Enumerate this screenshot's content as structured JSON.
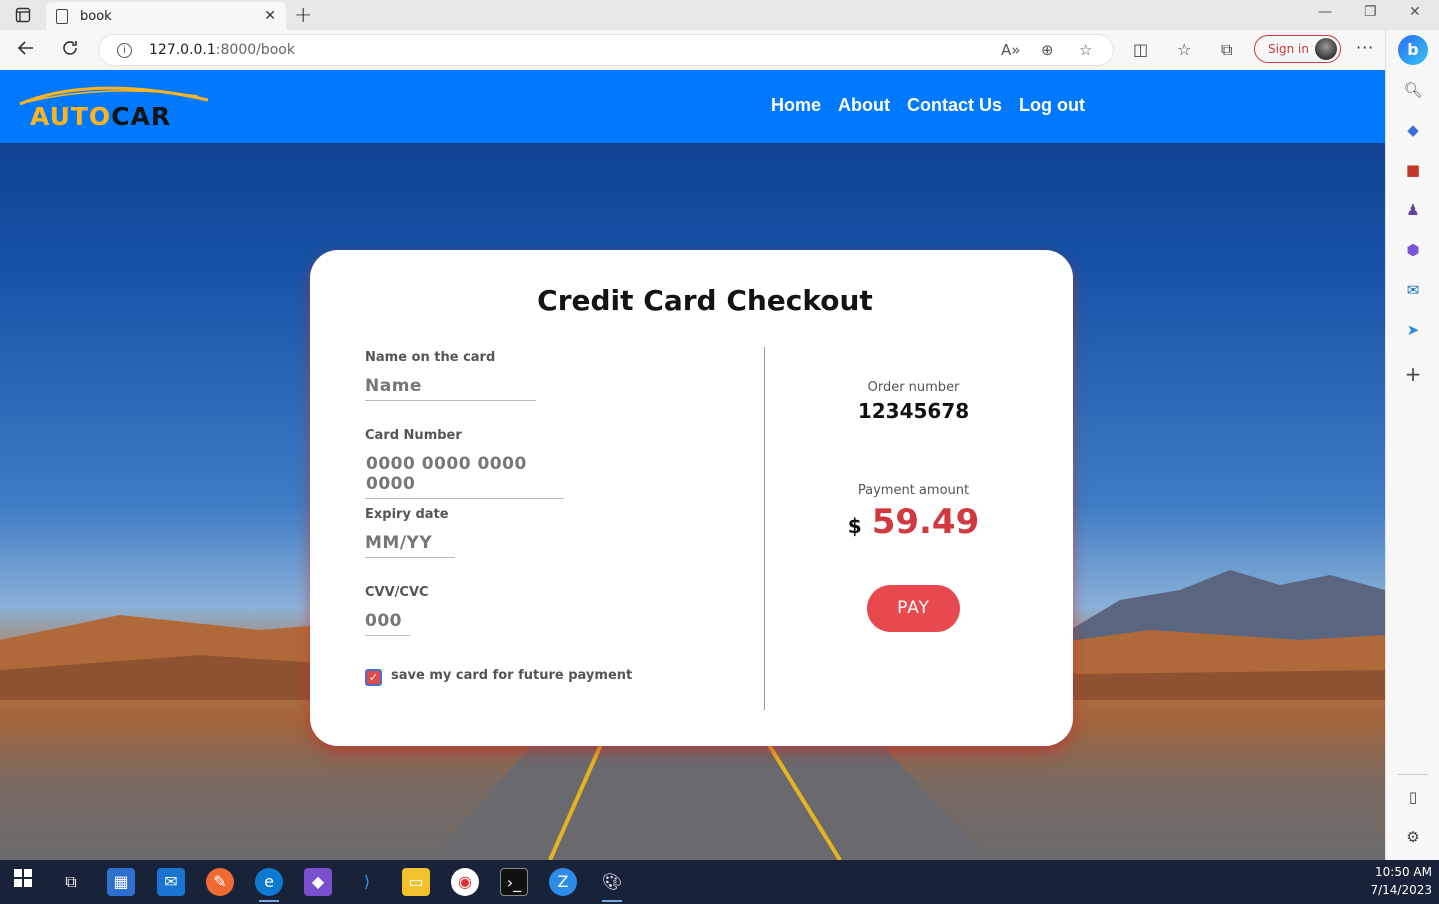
{
  "browser": {
    "tab_title": "book",
    "url_host": "127.0.0.1",
    "url_path": ":8000/book",
    "signin_label": "Sign in"
  },
  "navbar": {
    "logo": {
      "auto": "AUTO",
      "car": "CAR"
    },
    "links": [
      "Home",
      "About",
      "Contact Us",
      "Log out"
    ]
  },
  "checkout": {
    "title": "Credit Card Checkout",
    "name_label": "Name on the card",
    "name_placeholder": "Name",
    "card_label": "Card Number",
    "card_placeholder": "0000 0000 0000 0000",
    "expiry_label": "Expiry date",
    "expiry_placeholder": "MM/YY",
    "cvv_label": "CVV/CVC",
    "cvv_placeholder": "000",
    "save_label": "save my card for future payment",
    "save_checked": true,
    "order_label": "Order number",
    "order_number": "12345678",
    "amount_label": "Payment amount",
    "currency": "$",
    "amount": "59.49",
    "pay_label": "PAY"
  },
  "taskbar": {
    "time": "10:50 AM",
    "date": "7/14/2023"
  },
  "colors": {
    "navbar": "#0079fe",
    "accent": "#e8494f",
    "amount": "#d0393f",
    "logo_auto": "#ffb41e"
  }
}
